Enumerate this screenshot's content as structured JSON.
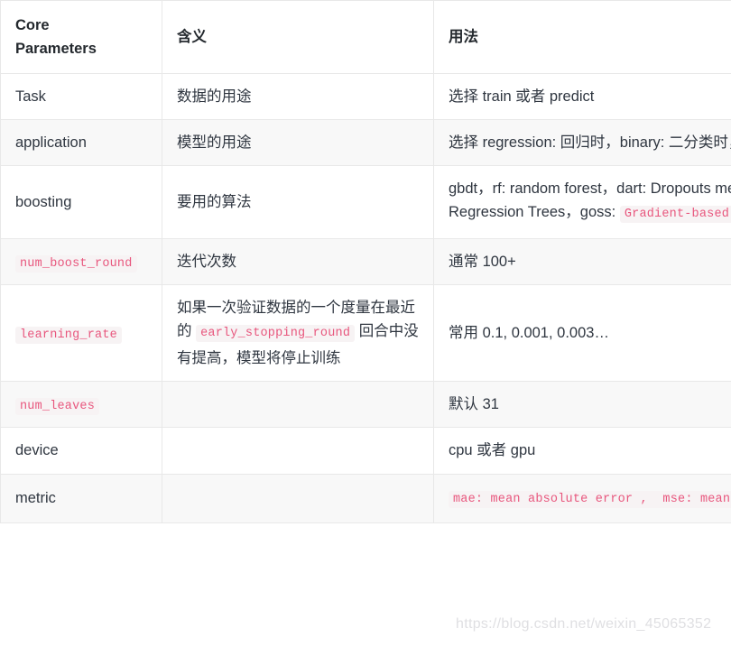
{
  "table": {
    "headers": [
      "Core\nParameters",
      "含义",
      "用法"
    ],
    "rows": [
      {
        "param": "Task",
        "param_code": false,
        "meaning": "数据的用途",
        "usage_pre": "选择 train 或者 predict",
        "usage_code": "",
        "usage_post": ""
      },
      {
        "param": "application",
        "param_code": false,
        "meaning": "模型的用途",
        "usage_pre": "选择 regression: 回归时，binary: 二分类时，multiclass: 多分类时",
        "usage_code": "",
        "usage_post": ""
      },
      {
        "param": "boosting",
        "param_code": false,
        "meaning": "要用的算法",
        "usage_pre": "gbdt，rf: random forest，dart: Dropouts meet Multiple Additive Regression Trees，goss: ",
        "usage_code": "Gradient-based One-Side Sampling",
        "usage_post": ""
      },
      {
        "param": "num_boost_round",
        "param_code": true,
        "meaning": "迭代次数",
        "usage_pre": "通常 100+",
        "usage_code": "",
        "usage_post": ""
      },
      {
        "param": "learning_rate",
        "param_code": true,
        "meaning_pre": "如果一次验证数据的一个度量在最近的 ",
        "meaning_code": "early_stopping_round",
        "meaning_post": " 回合中没有提高，模型将停止训练",
        "meaning": "",
        "usage_pre": "常用 0.1, 0.001, 0.003…",
        "usage_code": "",
        "usage_post": ""
      },
      {
        "param": "num_leaves",
        "param_code": true,
        "meaning": "",
        "usage_pre": "默认 31",
        "usage_code": "",
        "usage_post": ""
      },
      {
        "param": "device",
        "param_code": false,
        "meaning": "",
        "usage_pre": "cpu 或者 gpu",
        "usage_code": "",
        "usage_post": ""
      },
      {
        "param": "metric",
        "param_code": false,
        "meaning": "",
        "usage_pre": "",
        "usage_code": "mae: mean absolute error ,  mse: mean squared error ,  binary_logloss: loss for binary",
        "usage_post": ""
      }
    ]
  },
  "watermark": {
    "text": "https://blog.csdn.net/weixin_45065352"
  },
  "colors": {
    "code_text": "#e8567d",
    "code_background": "#f7f3f4",
    "row_alt_background": "#f8f8f8",
    "border": "#e8e8e8",
    "text": "#2f3640"
  }
}
